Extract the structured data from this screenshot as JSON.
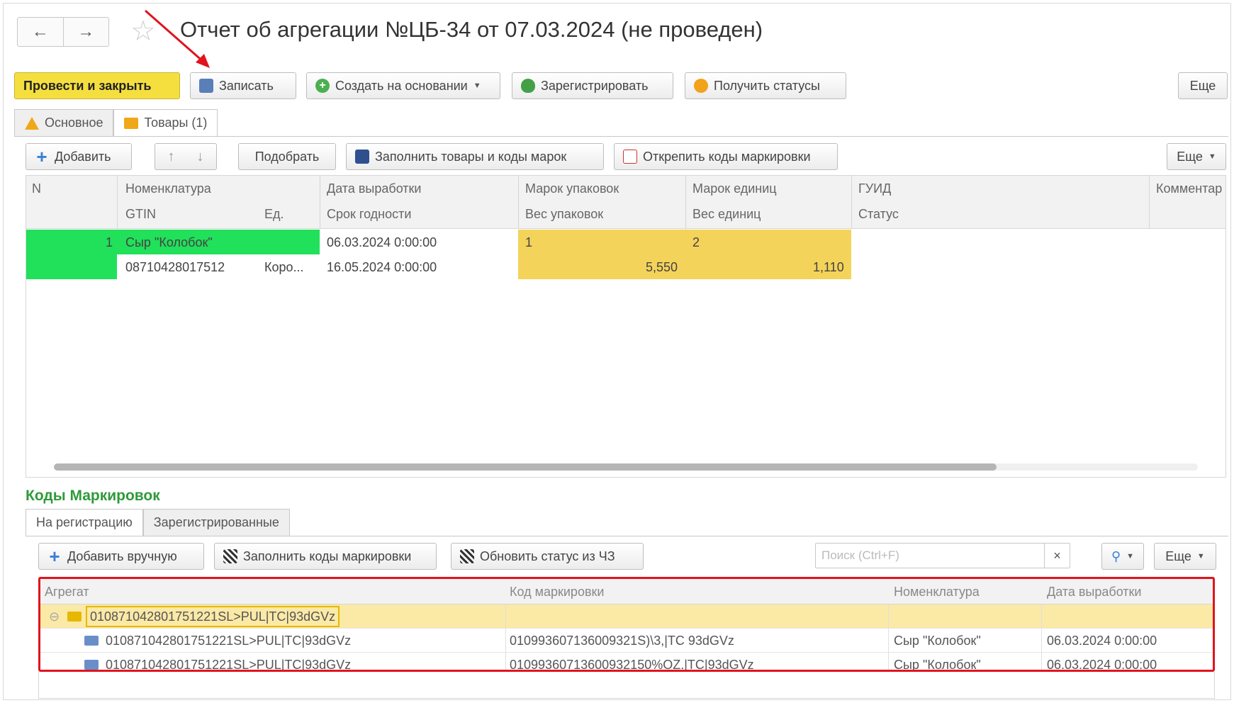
{
  "window": {
    "title": "Отчет об агрегации №ЦБ-34 от 07.03.2024 (не проведен)"
  },
  "toolbar": {
    "post_close": "Провести и закрыть",
    "save": "Записать",
    "create_based": "Создать на основании",
    "register": "Зарегистрировать",
    "get_statuses": "Получить статусы",
    "more": "Еще"
  },
  "tabs": [
    {
      "label": "Основное"
    },
    {
      "label": "Товары (1)"
    }
  ],
  "goods_toolbar": {
    "add": "Добавить",
    "pick": "Подобрать",
    "fill": "Заполнить товары и коды марок",
    "unpin": "Открепить коды маркировки",
    "more": "Еще"
  },
  "goods_table": {
    "headers_top": [
      "N",
      "Номенклатура",
      "Дата выработки",
      "Марок упаковок",
      "Марок единиц",
      "ГУИД",
      "Комментар"
    ],
    "headers_bottom": [
      "GTIN",
      "Ед.",
      "Срок годности",
      "Вес упаковок",
      "Вес единиц",
      "Статус"
    ],
    "row": {
      "n": "1",
      "nomenclature": "Сыр \"Колобок\"",
      "prod_date": "06.03.2024 0:00:00",
      "pack_marks": "1",
      "unit_marks": "2",
      "gtin": "08710428017512",
      "unit": "Коро...",
      "expiry": "16.05.2024 0:00:00",
      "pack_weight": "5,550",
      "unit_weight": "1,110"
    }
  },
  "codes": {
    "title": "Коды Маркировок",
    "tabs": [
      {
        "label": "На регистрацию"
      },
      {
        "label": "Зарегистрированные"
      }
    ],
    "toolbar": {
      "add_manual": "Добавить вручную",
      "fill": "Заполнить коды маркировки",
      "update_status": "Обновить статус из ЧЗ",
      "search_placeholder": "Поиск (Ctrl+F)",
      "more": "Еще"
    },
    "headers": [
      "Агрегат",
      "Код маркировки",
      "Номенклатура",
      "Дата выработки"
    ],
    "rows": [
      {
        "aggregate": "010871042801751221SL>PUL|TC|93dGVz",
        "code": "",
        "nomenclature": "",
        "date": ""
      },
      {
        "aggregate": "010871042801751221SL>PUL|TC|93dGVz",
        "code": "010993607136009321S)\\3,|TC 93dGVz",
        "nomenclature": "Сыр \"Колобок\"",
        "date": "06.03.2024 0:00:00"
      },
      {
        "aggregate": "010871042801751221SL>PUL|TC|93dGVz",
        "code": "01099360713600932150%OZ.|TC|93dGVz",
        "nomenclature": "Сыр \"Колобок\"",
        "date": "06.03.2024 0:00:00"
      }
    ]
  },
  "colors": {
    "primary_button": "#f5df3f",
    "green_highlight": "#21e05a",
    "yellow_highlight": "#f4d35a",
    "section_title": "#2e9a3a",
    "red_outline": "#e0141e"
  },
  "icons": [
    "back-arrow-icon",
    "forward-arrow-icon",
    "star-icon",
    "save-icon",
    "plus-icon",
    "shield-icon",
    "refresh-icon",
    "warning-icon",
    "cart-icon",
    "up-arrow-icon",
    "down-arrow-icon",
    "fill-icon",
    "unpin-icon",
    "qr-icon",
    "search-icon",
    "box-icon"
  ]
}
